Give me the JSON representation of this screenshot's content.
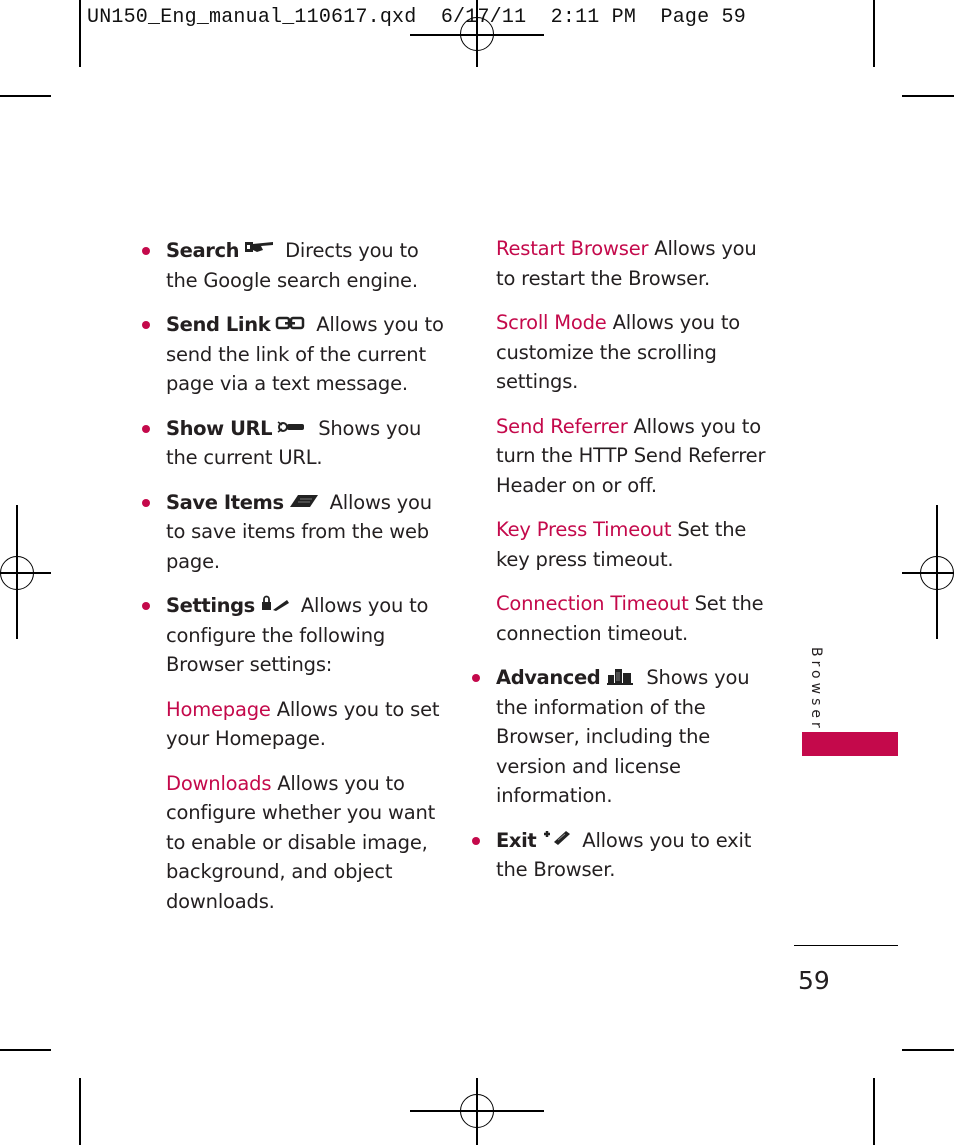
{
  "slug": {
    "text": "UN150_Eng_manual_110617.qxd  6/17/11  2:11 PM  Page 59"
  },
  "left_column": {
    "items": [
      {
        "term": "Search",
        "icon": "search-pointer-icon",
        "text": " Directs you to the Google search engine."
      },
      {
        "term": "Send Link",
        "icon": "chain-link-icon",
        "text": " Allows you to send the link of the current page via a text message."
      },
      {
        "term": "Show URL",
        "icon": "url-key-icon",
        "text": " Shows you the current URL."
      },
      {
        "term": "Save Items",
        "icon": "save-page-icon",
        "text": " Allows you to save items from the web page."
      },
      {
        "term": "Settings",
        "icon": "lock-tools-icon",
        "text": " Allows you to configure the following Browser settings:"
      }
    ],
    "sub_items": [
      {
        "term": "Homepage",
        "text": " Allows you to set your Homepage."
      },
      {
        "term": "Downloads",
        "text": " Allows you to configure whether you want to enable or disable image, background, and object downloads."
      }
    ]
  },
  "right_column": {
    "sub_items": [
      {
        "term": "Restart Browser",
        "text": " Allows you to restart the Browser."
      },
      {
        "term": "Scroll Mode",
        "text": " Allows you to customize the scrolling settings."
      },
      {
        "term": "Send Referrer",
        "text": " Allows you to turn the HTTP Send Referrer Header on or off."
      },
      {
        "term": "Key Press Timeout",
        "text": " Set the key press timeout."
      },
      {
        "term": "Connection Timeout",
        "text": " Set the connection timeout."
      }
    ],
    "items": [
      {
        "term": "Advanced",
        "icon": "building-info-icon",
        "text": " Shows you the information of the Browser, including the version and license information."
      },
      {
        "term": "Exit",
        "icon": "exit-phone-icon",
        "text": " Allows you to exit the Browser."
      }
    ]
  },
  "sidebar": {
    "section_label": "Browser",
    "accent_color": "#c4094b"
  },
  "footer": {
    "page_number": "59"
  }
}
